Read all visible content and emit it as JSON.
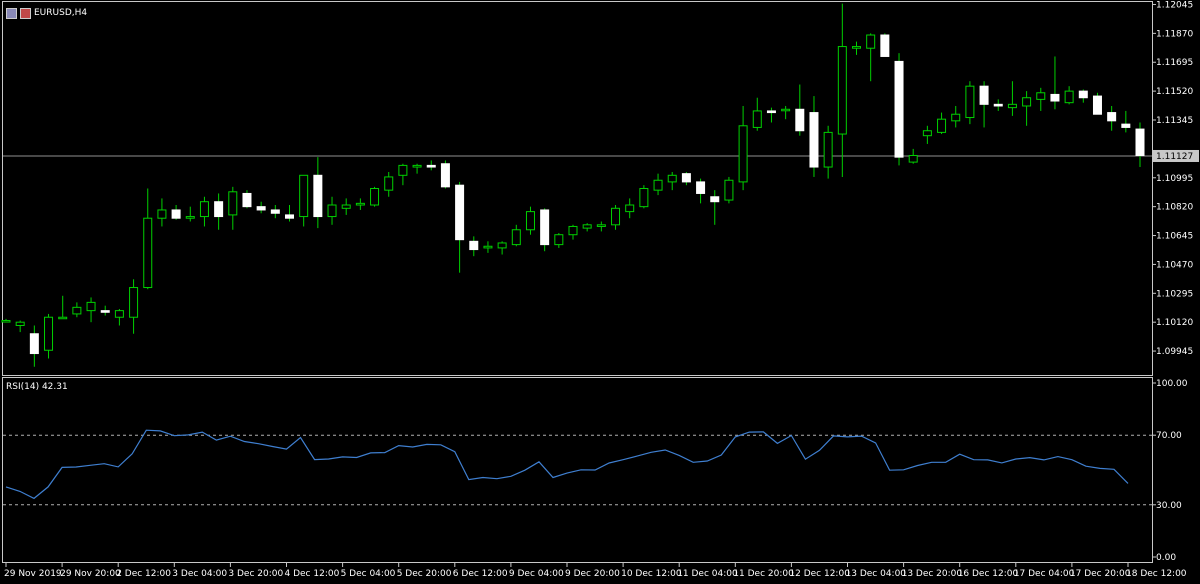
{
  "header": {
    "symbol": "EURUSD,H4",
    "icons": [
      "chart-type-icon",
      "flag-icon"
    ]
  },
  "colors": {
    "background": "#000000",
    "up_border": "#00d000",
    "body_fill": "#ffffff",
    "wick": "#00d000",
    "rsi_line": "#3f7fd0",
    "grid_dashed": "#b0b0b0",
    "axis_text": "#ffffff",
    "price_line": "#909090"
  },
  "chart_data": [
    {
      "type": "candlestick",
      "ylim": [
        1.098,
        1.1206
      ],
      "price_ticks": [
        "1.12045",
        "1.11870",
        "1.11695",
        "1.11520",
        "1.11345",
        "1.10995",
        "1.10820",
        "1.10645",
        "1.10470",
        "1.10295",
        "1.10120",
        "1.09945"
      ],
      "current_price": "1.11127",
      "x_labels": [
        "29 Nov 2019",
        "29 Nov 20:00",
        "2 Dec 12:00",
        "3 Dec 04:00",
        "3 Dec 20:00",
        "4 Dec 12:00",
        "5 Dec 04:00",
        "5 Dec 20:00",
        "6 Dec 12:00",
        "9 Dec 04:00",
        "9 Dec 20:00",
        "10 Dec 12:00",
        "11 Dec 04:00",
        "11 Dec 20:00",
        "12 Dec 12:00",
        "13 Dec 04:00",
        "13 Dec 20:00",
        "16 Dec 12:00",
        "17 Dec 04:00",
        "17 Dec 20:00",
        "18 Dec 12:00"
      ],
      "ohlc": [
        [
          1.1013,
          1.1014,
          1.1012,
          1.1013
        ],
        [
          1.101,
          1.1013,
          1.1006,
          1.1012
        ],
        [
          1.1005,
          1.101,
          1.0985,
          1.0993
        ],
        [
          1.0995,
          1.1017,
          1.099,
          1.1015
        ],
        [
          1.1015,
          1.1028,
          1.1014,
          1.1015
        ],
        [
          1.1017,
          1.1024,
          1.1015,
          1.1021
        ],
        [
          1.1019,
          1.1027,
          1.1012,
          1.1024
        ],
        [
          1.1019,
          1.1022,
          1.1016,
          1.1018
        ],
        [
          1.1015,
          1.102,
          1.101,
          1.1019
        ],
        [
          1.1015,
          1.1038,
          1.1005,
          1.1033
        ],
        [
          1.1033,
          1.1093,
          1.1032,
          1.1075
        ],
        [
          1.1075,
          1.1087,
          1.107,
          1.108
        ],
        [
          1.108,
          1.1083,
          1.1074,
          1.1075
        ],
        [
          1.1075,
          1.1082,
          1.1073,
          1.1076
        ],
        [
          1.1076,
          1.1088,
          1.107,
          1.1085
        ],
        [
          1.1085,
          1.109,
          1.1068,
          1.1076
        ],
        [
          1.1077,
          1.1094,
          1.1068,
          1.1091
        ],
        [
          1.109,
          1.1092,
          1.1081,
          1.1082
        ],
        [
          1.1082,
          1.1085,
          1.1078,
          1.108
        ],
        [
          1.108,
          1.1083,
          1.1075,
          1.1078
        ],
        [
          1.1077,
          1.1083,
          1.1073,
          1.1075
        ],
        [
          1.1076,
          1.1101,
          1.107,
          1.1101
        ],
        [
          1.1101,
          1.1112,
          1.1069,
          1.1076
        ],
        [
          1.1076,
          1.1088,
          1.1071,
          1.1083
        ],
        [
          1.1081,
          1.1087,
          1.1077,
          1.1083
        ],
        [
          1.1083,
          1.1087,
          1.108,
          1.1084
        ],
        [
          1.1083,
          1.1094,
          1.1082,
          1.1093
        ],
        [
          1.1092,
          1.1103,
          1.1088,
          1.11
        ],
        [
          1.1101,
          1.1108,
          1.1095,
          1.1107
        ],
        [
          1.1106,
          1.1108,
          1.1102,
          1.1107
        ],
        [
          1.1107,
          1.111,
          1.1104,
          1.1106
        ],
        [
          1.1108,
          1.111,
          1.1093,
          1.1094
        ],
        [
          1.1095,
          1.1097,
          1.1042,
          1.1062
        ],
        [
          1.1061,
          1.1064,
          1.1052,
          1.1056
        ],
        [
          1.1057,
          1.1061,
          1.1054,
          1.1058
        ],
        [
          1.1057,
          1.1061,
          1.1053,
          1.106
        ],
        [
          1.1059,
          1.1071,
          1.1058,
          1.1068
        ],
        [
          1.1068,
          1.1082,
          1.1065,
          1.1079
        ],
        [
          1.108,
          1.1081,
          1.1055,
          1.1059
        ],
        [
          1.1059,
          1.1066,
          1.1057,
          1.1065
        ],
        [
          1.1065,
          1.1071,
          1.1062,
          1.107
        ],
        [
          1.1069,
          1.1072,
          1.1067,
          1.1071
        ],
        [
          1.107,
          1.1073,
          1.1067,
          1.1071
        ],
        [
          1.1071,
          1.1083,
          1.1068,
          1.1081
        ],
        [
          1.1079,
          1.1087,
          1.1075,
          1.1083
        ],
        [
          1.1082,
          1.1095,
          1.1081,
          1.1093
        ],
        [
          1.1092,
          1.1102,
          1.1089,
          1.1098
        ],
        [
          1.1097,
          1.1103,
          1.1092,
          1.1101
        ],
        [
          1.1102,
          1.1103,
          1.1095,
          1.1097
        ],
        [
          1.1097,
          1.1099,
          1.1084,
          1.109
        ],
        [
          1.1088,
          1.1092,
          1.1071,
          1.1085
        ],
        [
          1.1086,
          1.11,
          1.1084,
          1.1098
        ],
        [
          1.1097,
          1.1143,
          1.1092,
          1.1131
        ],
        [
          1.113,
          1.1148,
          1.1128,
          1.114
        ],
        [
          1.114,
          1.1142,
          1.1133,
          1.1139
        ],
        [
          1.1141,
          1.1143,
          1.1135,
          1.1141
        ],
        [
          1.1141,
          1.1156,
          1.1125,
          1.1128
        ],
        [
          1.1139,
          1.1149,
          1.11,
          1.1106
        ],
        [
          1.1106,
          1.1131,
          1.1099,
          1.1127
        ],
        [
          1.1126,
          1.1205,
          1.11,
          1.1179
        ],
        [
          1.1178,
          1.1182,
          1.1174,
          1.1179
        ],
        [
          1.1178,
          1.1187,
          1.1158,
          1.1186
        ],
        [
          1.1186,
          1.1187,
          1.1175,
          1.1173
        ],
        [
          1.117,
          1.1175,
          1.1107,
          1.1112
        ],
        [
          1.1109,
          1.1117,
          1.1108,
          1.1113
        ],
        [
          1.1125,
          1.1131,
          1.112,
          1.1128
        ],
        [
          1.1127,
          1.1139,
          1.1126,
          1.1135
        ],
        [
          1.1134,
          1.1143,
          1.113,
          1.1138
        ],
        [
          1.1136,
          1.1158,
          1.1132,
          1.1155
        ],
        [
          1.1155,
          1.1158,
          1.113,
          1.1144
        ],
        [
          1.1144,
          1.1147,
          1.114,
          1.1143
        ],
        [
          1.1142,
          1.1158,
          1.1137,
          1.1144
        ],
        [
          1.1143,
          1.1152,
          1.1131,
          1.1148
        ],
        [
          1.1147,
          1.1154,
          1.114,
          1.1151
        ],
        [
          1.115,
          1.1173,
          1.1141,
          1.1146
        ],
        [
          1.1145,
          1.1155,
          1.1144,
          1.1152
        ],
        [
          1.1152,
          1.1153,
          1.1145,
          1.1148
        ],
        [
          1.1149,
          1.1151,
          1.114,
          1.1138
        ],
        [
          1.1139,
          1.1143,
          1.1128,
          1.1134
        ],
        [
          1.1132,
          1.114,
          1.1127,
          1.113
        ],
        [
          1.1129,
          1.1133,
          1.1106,
          1.1113
        ]
      ]
    },
    {
      "type": "line",
      "label": "RSI(14) 42.31",
      "ylim": [
        0,
        100
      ],
      "y_ticks": [
        "100.00",
        "70.00",
        "30.00",
        "0.00"
      ],
      "levels": [
        70,
        30
      ],
      "values": [
        40.3,
        37.7,
        33.7,
        40.3,
        51.5,
        51.7,
        52.7,
        53.6,
        51.8,
        59.3,
        72.9,
        72.5,
        69.7,
        70.2,
        71.8,
        67.2,
        69.4,
        66.4,
        65.1,
        63.5,
        62.0,
        68.7,
        56.0,
        56.3,
        57.5,
        57.2,
        59.8,
        60.0,
        64.0,
        63.2,
        64.7,
        64.5,
        60.5,
        44.5,
        45.7,
        45.0,
        46.4,
        49.9,
        54.7,
        45.7,
        48.2,
        50.1,
        50.0,
        54.0,
        55.9,
        58.0,
        60.2,
        61.5,
        58.4,
        54.4,
        55.2,
        58.6,
        69.0,
        71.8,
        71.9,
        65.3,
        69.8,
        56.2,
        61.3,
        69.6,
        69.0,
        69.5,
        65.6,
        49.9,
        50.1,
        52.6,
        54.4,
        54.4,
        59.1,
        55.9,
        55.8,
        54.1,
        56.3,
        57.1,
        55.8,
        57.7,
        55.9,
        52.2,
        50.9,
        50.4,
        42.3
      ]
    }
  ]
}
